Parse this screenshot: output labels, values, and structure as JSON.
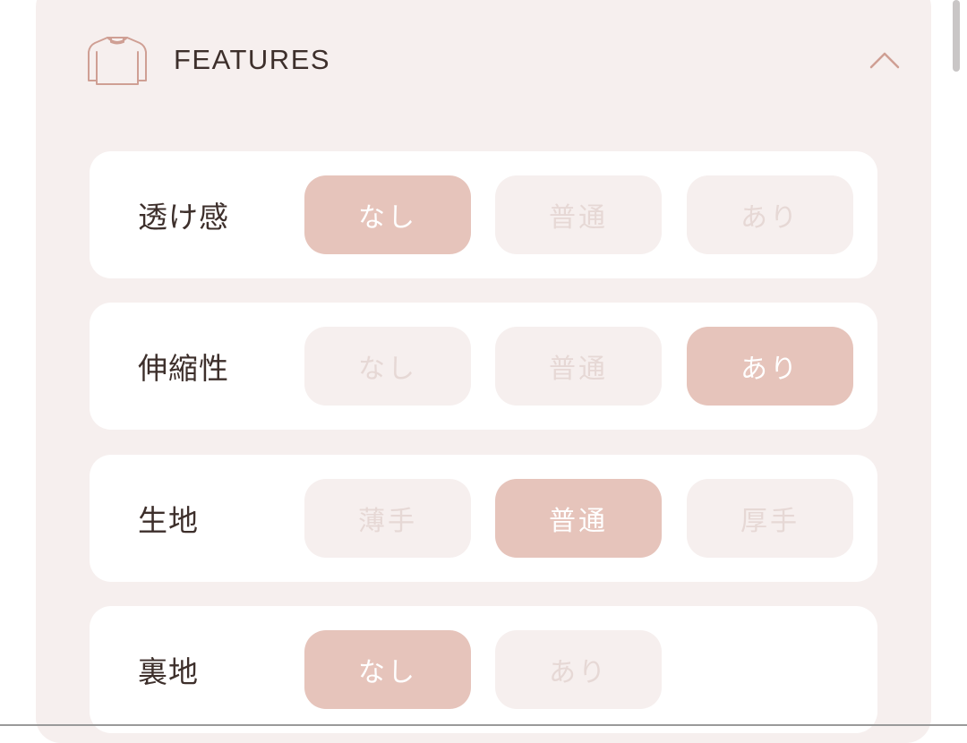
{
  "colors": {
    "panel_bg": "#f6efee",
    "row_bg": "#ffffff",
    "accent_selected": "#e6c4bb",
    "icon_stroke": "#cf9f94",
    "title_text": "#3d2f2b",
    "option_inactive_text": "#e6d8d5"
  },
  "section": {
    "icon": "shirt-icon",
    "title": "FEATURES",
    "toggle_icon": "chevron-up-icon"
  },
  "rows": [
    {
      "label": "透け感",
      "options": [
        {
          "label": "なし",
          "selected": true
        },
        {
          "label": "普通",
          "selected": false
        },
        {
          "label": "あり",
          "selected": false
        }
      ]
    },
    {
      "label": "伸縮性",
      "options": [
        {
          "label": "なし",
          "selected": false
        },
        {
          "label": "普通",
          "selected": false
        },
        {
          "label": "あり",
          "selected": true
        }
      ]
    },
    {
      "label": "生地",
      "options": [
        {
          "label": "薄手",
          "selected": false
        },
        {
          "label": "普通",
          "selected": true
        },
        {
          "label": "厚手",
          "selected": false
        }
      ]
    },
    {
      "label": "裏地",
      "options": [
        {
          "label": "なし",
          "selected": true
        },
        {
          "label": "あり",
          "selected": false
        }
      ]
    }
  ]
}
